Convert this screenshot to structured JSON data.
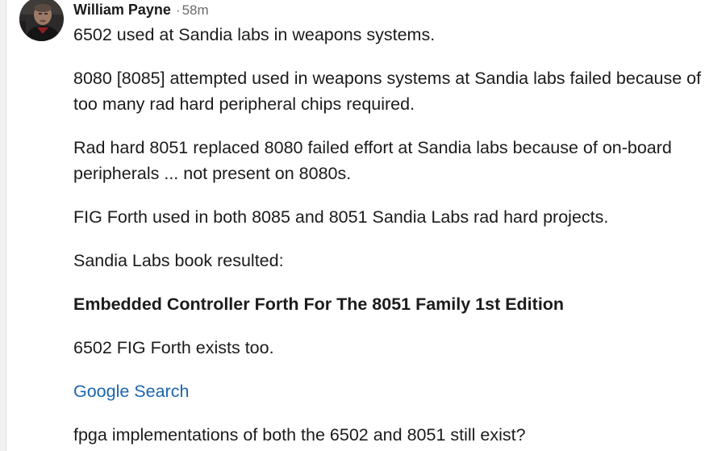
{
  "comment": {
    "author": "William Payne",
    "separator": "·",
    "time": "58m",
    "paragraphs": [
      "6502 used at Sandia labs in weapons systems.",
      "8080 [8085] attempted used in weapons systems at Sandia labs failed because of too many rad hard peripheral chips required.",
      "Rad hard 8051 replaced 8080 failed effort at Sandia labs because of on-board peripherals ... not present on 8080s.",
      "FIG Forth used in both 8085 and 8051 Sandia Labs rad hard projects.",
      "Sandia Labs book resulted:",
      "Embedded Controller Forth For The 8051 Family 1st Edition",
      "6502 FIG Forth exists too.",
      "Google Search",
      "fpga implementations of both the 6502 and 8051 still exist?"
    ]
  },
  "colors": {
    "link": "#1a66b0",
    "text": "#1b1b1b",
    "meta": "#6b6b6b"
  },
  "icons": {
    "avatar": "user-photo-avatar"
  }
}
